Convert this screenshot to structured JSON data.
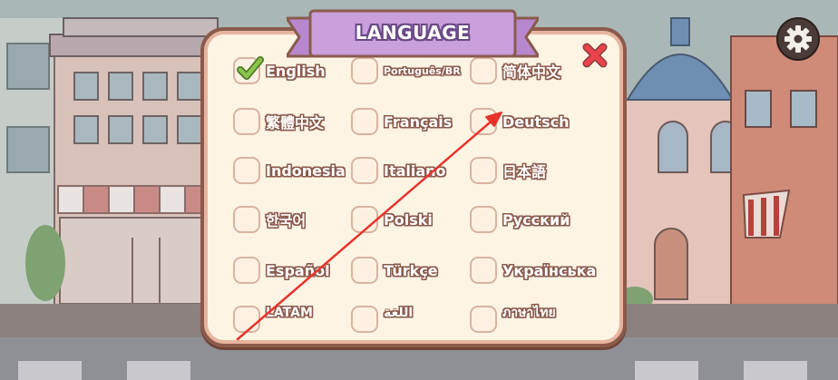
{
  "dialog": {
    "title": "LANGUAGE",
    "selected": "English",
    "languages": [
      {
        "label": "English",
        "checked": true
      },
      {
        "label": "Português/BR",
        "checked": false
      },
      {
        "label": "简体中文",
        "checked": false
      },
      {
        "label": "繁體中文",
        "checked": false
      },
      {
        "label": "Français",
        "checked": false
      },
      {
        "label": "Deutsch",
        "checked": false
      },
      {
        "label": "Indonesia",
        "checked": false
      },
      {
        "label": "Italiano",
        "checked": false
      },
      {
        "label": "日本語",
        "checked": false
      },
      {
        "label": "한국어",
        "checked": false
      },
      {
        "label": "Polski",
        "checked": false
      },
      {
        "label": "Русский",
        "checked": false
      },
      {
        "label": "Español",
        "checked": false
      },
      {
        "label": "Türkçe",
        "checked": false
      },
      {
        "label": "Українська",
        "checked": false
      },
      {
        "label": "LATAM",
        "checked": false
      },
      {
        "label": "اللغة",
        "checked": false
      },
      {
        "label": "ภาษาไทย",
        "checked": false
      }
    ]
  },
  "icons": {
    "close": "close-x-icon",
    "settings": "gear-icon",
    "check": "checkmark-icon"
  },
  "colors": {
    "banner": "#c99fdc",
    "close": "#e8434b",
    "check": "#8bc34a",
    "dialog_bg": "#fdf4e4",
    "dialog_border": "#8c5a4a",
    "annotation_arrow": "#e8332c"
  }
}
